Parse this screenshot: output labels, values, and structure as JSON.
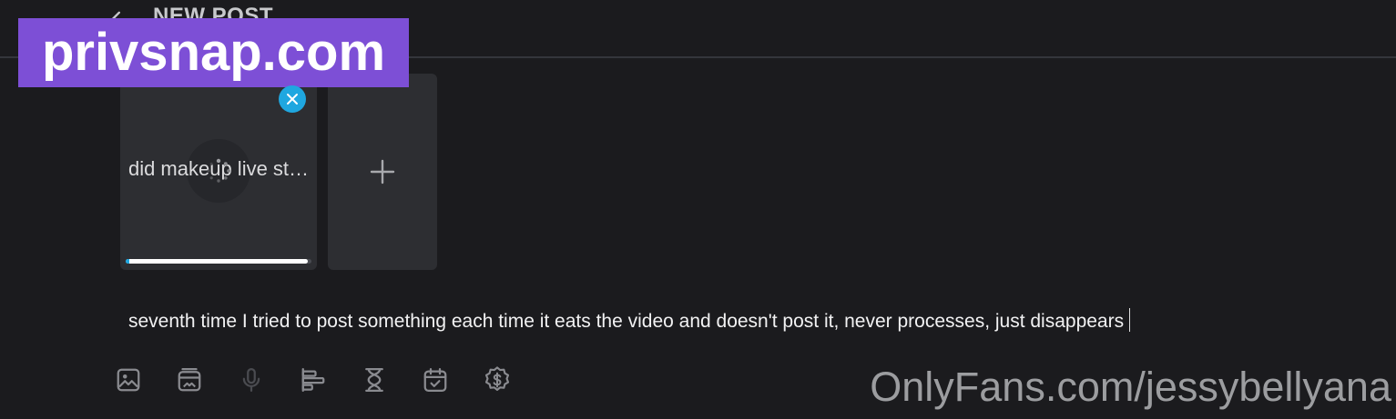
{
  "header": {
    "title": "NEW POST"
  },
  "watermarks": {
    "site": "privsnap.com",
    "profile": "OnlyFans.com/jessybellyana"
  },
  "media": {
    "filename": "did makeup live st…",
    "upload_progress": 0.98
  },
  "composer": {
    "text": "seventh time I tried to post something each time it eats the video and doesn't post it, never processes, just disappears"
  },
  "toolbar": {
    "icons": [
      "image-icon",
      "vault-icon",
      "microphone-icon",
      "poll-icon",
      "timer-icon",
      "schedule-icon",
      "price-icon"
    ]
  },
  "colors": {
    "background": "#1b1b1e",
    "card": "#2d2e32",
    "accent": "#1fa7e0",
    "watermark_bg": "#7d4fd6"
  }
}
